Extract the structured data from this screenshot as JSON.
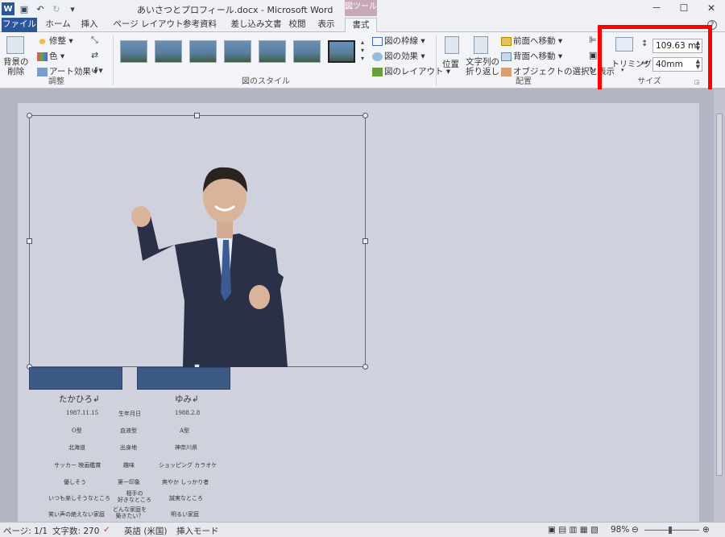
{
  "window": {
    "title": "あいさつとプロフィール.docx - Microsoft Word",
    "tool_tab_label": "図ツール",
    "controls": [
      "－",
      "☐",
      "✕"
    ]
  },
  "tabs": [
    "ファイル",
    "ホーム",
    "挿入",
    "ページ レイアウト",
    "参考資料",
    "差し込み文書",
    "校閲",
    "表示",
    "書式"
  ],
  "ribbon": {
    "adjust": {
      "remove_bg": "背景の\n削除",
      "corrections": "修整",
      "color": "色",
      "artistic": "アート効果",
      "label": "調整"
    },
    "picture_styles": {
      "border": "図の枠線",
      "effects": "図の効果",
      "layout": "図のレイアウト",
      "label": "図のスタイル"
    },
    "arrange": {
      "position": "位置",
      "wrap": "文字列の\n折り返し",
      "bring_forward": "前面へ移動",
      "send_backward": "背面へ移動",
      "selection_pane": "オブジェクトの選択と表示",
      "label": "配置"
    },
    "size": {
      "crop": "トリミング",
      "height": "109.63 mi",
      "width": "40mm",
      "label": "サイズ"
    }
  },
  "document": {
    "names": [
      "たかひろ↲",
      "ゆみ↲"
    ],
    "profile_rows": [
      [
        "1987.11.15",
        "生年月日",
        "1988.2.8"
      ],
      [
        "O型",
        "血液型",
        "A型"
      ],
      [
        "北海道",
        "出身地",
        "神奈川県"
      ],
      [
        "サッカー 映画鑑賞",
        "趣味",
        "ショッピング カラオケ"
      ],
      [
        "優しそう",
        "第一印象",
        "爽やか しっかり者"
      ],
      [
        "いつも楽しそうなところ",
        "相手の\n好きなところ",
        "誠実なところ"
      ],
      [
        "笑い声の絶えない家庭",
        "どんな家庭を\n築きたい？",
        "明るい家庭"
      ]
    ]
  },
  "statusbar": {
    "page": "ページ: 1/1",
    "words": "文字数: 270",
    "language": "英語 (米国)",
    "mode": "挿入モード",
    "zoom": "98%"
  }
}
